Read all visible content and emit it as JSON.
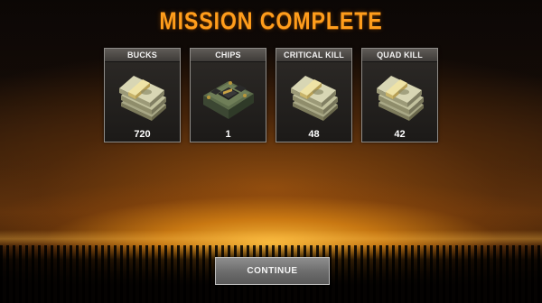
{
  "screen": {
    "title": "MISSION COMPLETE"
  },
  "rewards": [
    {
      "label": "BUCKS",
      "value": "720",
      "icon": "cash-stack-icon"
    },
    {
      "label": "CHIPS",
      "value": "1",
      "icon": "chip-box-icon"
    },
    {
      "label": "CRITICAL KILL",
      "value": "48",
      "icon": "cash-stack-icon"
    },
    {
      "label": "QUAD KILL",
      "value": "42",
      "icon": "cash-stack-icon"
    }
  ],
  "actions": {
    "continue_label": "CONTINUE"
  },
  "colors": {
    "title": "#ff9d1c",
    "card_border": "#8f8c88",
    "button": "#6b6b6b"
  }
}
